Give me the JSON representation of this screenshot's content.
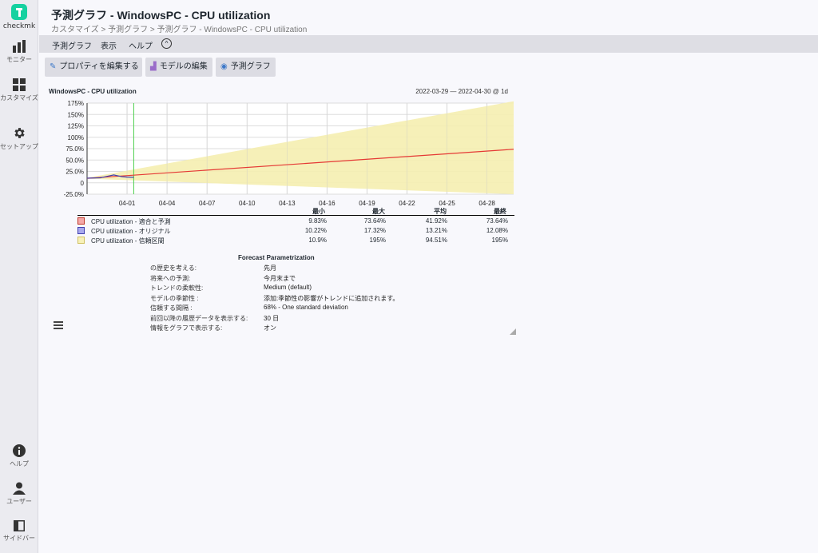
{
  "app": {
    "logo_text": "checkmk",
    "title": "予測グラフ - WindowsPC - CPU utilization",
    "breadcrumb": "カスタマイズ > 予測グラフ > 予測グラフ - WindowsPC - CPU utilization"
  },
  "sidebar": {
    "items": [
      {
        "label": "モニター",
        "icon": "bar-chart-icon"
      },
      {
        "label": "カスタマイズ",
        "icon": "grid-icon"
      },
      {
        "label": "セットアップ",
        "icon": "gear-icon"
      },
      {
        "label": "ヘルプ",
        "icon": "info-icon"
      },
      {
        "label": "ユーザー",
        "icon": "user-icon"
      },
      {
        "label": "サイドバー",
        "icon": "sidebar-icon"
      }
    ]
  },
  "menu": {
    "items": [
      "予測グラフ",
      "表示",
      "ヘルプ"
    ],
    "toggle_glyph": "^"
  },
  "toolbar": {
    "edit_properties": "プロパティを編集する",
    "edit_model": "モデルの編集",
    "forecast_graph": "予測グラフ"
  },
  "graph": {
    "title": "WindowsPC - CPU utilization",
    "range": "2022-03-29 — 2022-04-30 @ 1d"
  },
  "chart_data": {
    "type": "line",
    "title": "WindowsPC - CPU utilization",
    "y_ticks": [
      "175%",
      "150%",
      "125%",
      "100%",
      "75.0%",
      "50.0%",
      "25.0%",
      "0",
      "-25.0%"
    ],
    "x_ticks": [
      "04-01",
      "04-04",
      "04-07",
      "04-10",
      "04-13",
      "04-16",
      "04-19",
      "04-22",
      "04-25",
      "04-28"
    ],
    "ylim": [
      -25,
      175
    ],
    "xlim_days": [
      0,
      32
    ],
    "grid": true,
    "series": [
      {
        "name": "CPU utilization - 適合と予測",
        "color": "#e53935",
        "x": [
          0,
          32
        ],
        "y": [
          9.83,
          73.64
        ]
      },
      {
        "name": "CPU utilization - オリジナル",
        "color": "#3f3fb0",
        "x": [
          0,
          1,
          2,
          2.6,
          3,
          3.5
        ],
        "y": [
          10.2,
          11,
          17.3,
          13.5,
          12.5,
          12.08
        ]
      },
      {
        "name": "CPU utilization - 信頼区間",
        "color": "#f5eeb0",
        "x": [
          0,
          32
        ],
        "upper": [
          10.9,
          195
        ],
        "lower": [
          9,
          -47
        ]
      }
    ],
    "marker_x_day": 3.5,
    "legend": {
      "headers": [
        "最小",
        "最大",
        "平均",
        "最終"
      ],
      "rows": [
        {
          "name": "CPU utilization - 適合と予測",
          "color": "#f4a9a9",
          "border": "#c0392b",
          "min": "9.83%",
          "max": "73.64%",
          "avg": "41.92%",
          "last": "73.64%"
        },
        {
          "name": "CPU utilization - オリジナル",
          "color": "#a9a9ee",
          "border": "#3f3fb0",
          "min": "10.22%",
          "max": "17.32%",
          "avg": "13.21%",
          "last": "12.08%"
        },
        {
          "name": "CPU utilization - 信頼区間",
          "color": "#f7f1b9",
          "border": "#d0c060",
          "min": "10.9%",
          "max": "195%",
          "avg": "94.51%",
          "last": "195%"
        }
      ]
    }
  },
  "forecast": {
    "title": "Forecast Parametrization",
    "rows": [
      {
        "key": "の歴史を考える:",
        "value": "先月"
      },
      {
        "key": "将来への予測:",
        "value": "今月末まで"
      },
      {
        "key": "トレンドの柔軟性:",
        "value": "Medium (default)"
      },
      {
        "key": "モデルの季節性 :",
        "value": "添加:季節性の影響がトレンドに追加されます。"
      },
      {
        "key": "信頼する間隔 :",
        "value": "68% - One standard deviation"
      },
      {
        "key": "前回以降の履歴データを表示する:",
        "value": "30 日"
      },
      {
        "key": "情報をグラフで表示する:",
        "value": "オン"
      }
    ]
  }
}
